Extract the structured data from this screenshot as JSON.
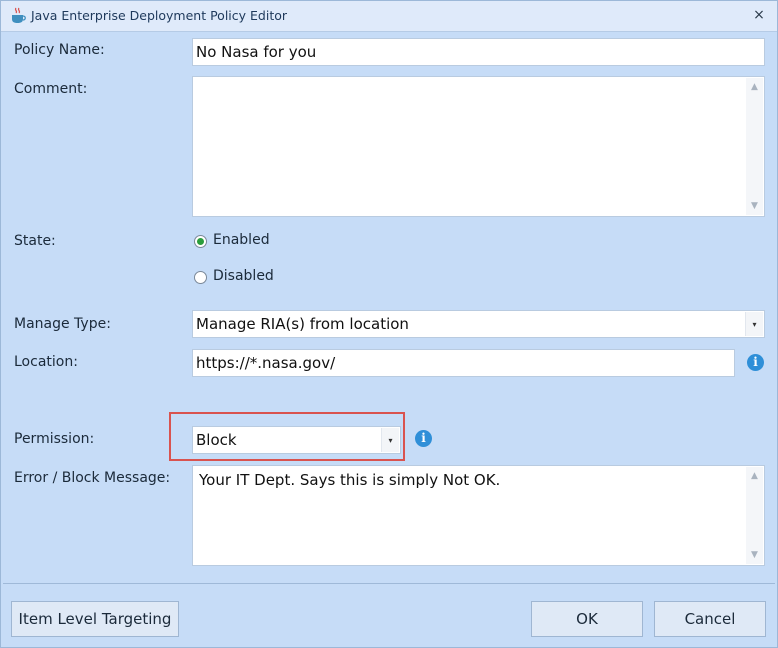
{
  "window": {
    "title": "Java Enterprise Deployment Policy Editor",
    "close_glyph": "×"
  },
  "form": {
    "policy_name": {
      "label": "Policy Name:",
      "value": "No Nasa for you"
    },
    "comment": {
      "label": "Comment:",
      "value": ""
    },
    "state": {
      "label": "State:",
      "options": [
        {
          "label": "Enabled",
          "checked": true
        },
        {
          "label": "Disabled",
          "checked": false
        }
      ]
    },
    "manage_type": {
      "label": "Manage Type:",
      "value": "Manage RIA(s) from location"
    },
    "location": {
      "label": "Location:",
      "value": "https://*.nasa.gov/"
    },
    "permission": {
      "label": "Permission:",
      "value": "Block"
    },
    "error_message": {
      "label": "Error / Block Message:",
      "value": "Your IT Dept. Says this is simply Not OK."
    }
  },
  "buttons": {
    "item_level_targeting": "Item Level Targeting",
    "ok": "OK",
    "cancel": "Cancel"
  },
  "icons": {
    "info": "i",
    "dropdown": "▾",
    "scroll_up": "▲",
    "scroll_down": "▼"
  },
  "colors": {
    "window_bg": "#c6dcf7",
    "highlight_border": "#d9534f",
    "radio_checked": "#2a9d3c",
    "info_icon": "#2f8fd8"
  }
}
